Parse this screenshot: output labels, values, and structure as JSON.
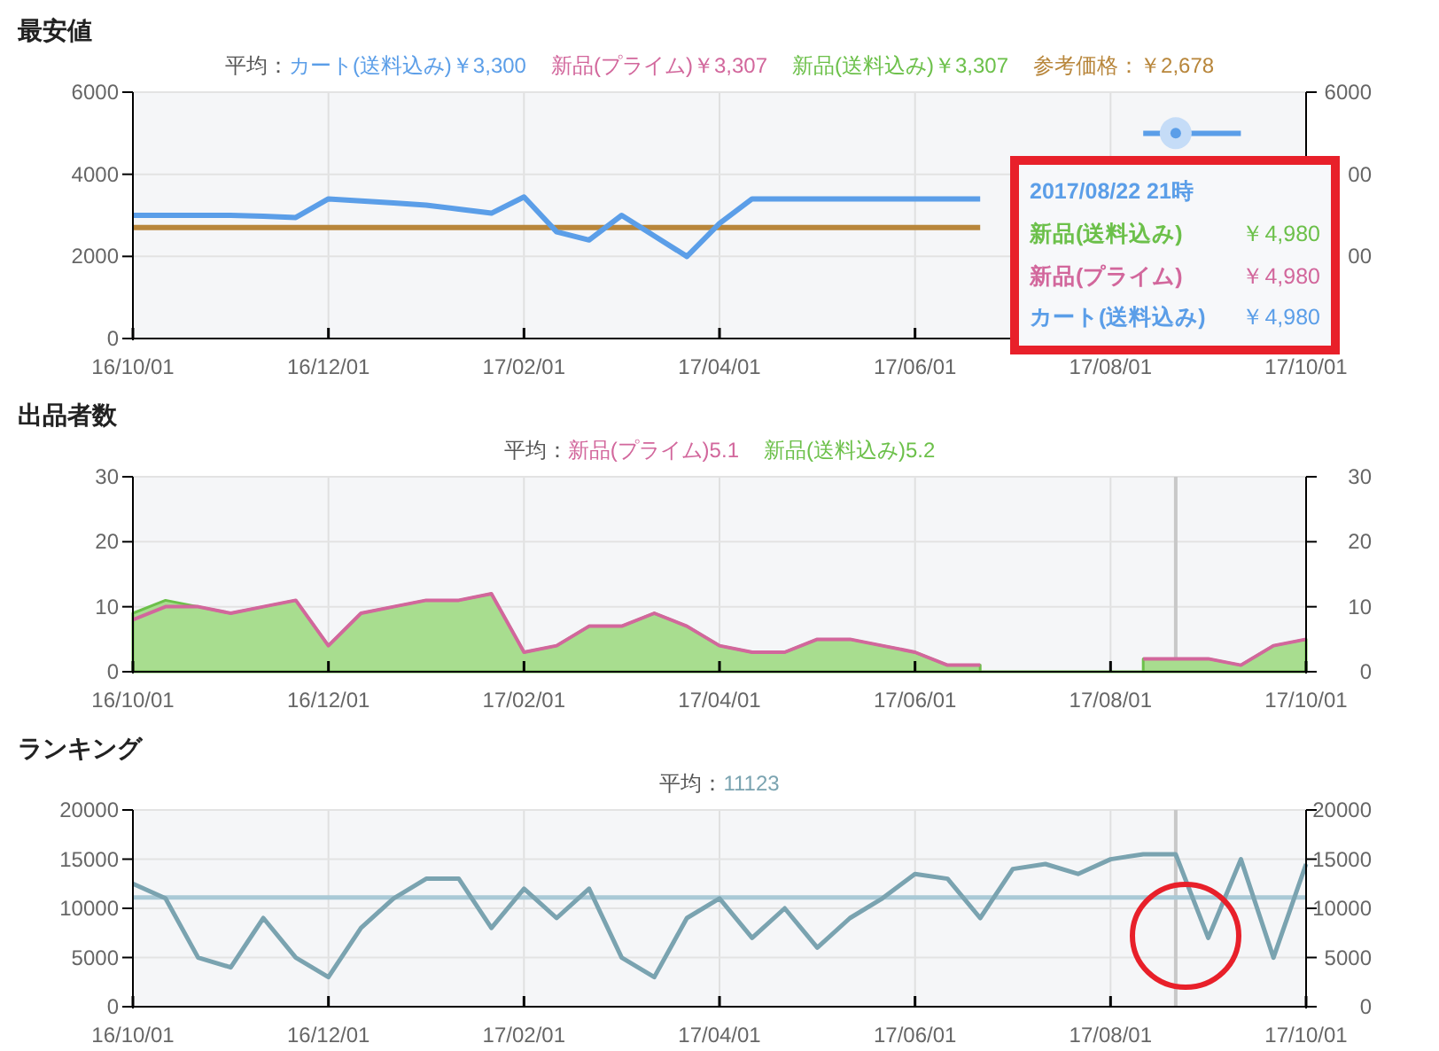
{
  "sections": [
    {
      "title": "最安値",
      "average": {
        "label": "平均：",
        "items": [
          {
            "text": "カート(送料込み)￥3,300",
            "color": "#5b9ee8"
          },
          {
            "text": "新品(プライム)￥3,307",
            "color": "#d2679c"
          },
          {
            "text": "新品(送料込み)￥3,307",
            "color": "#6cc04a"
          },
          {
            "text": "参考価格：￥2,678",
            "color": "#b8863b"
          }
        ]
      },
      "chart_data": {
        "type": "line",
        "categories": [
          "16/10/01",
          null,
          null,
          null,
          null,
          null,
          "16/12/01",
          null,
          null,
          null,
          null,
          null,
          "17/02/01",
          null,
          null,
          null,
          null,
          null,
          "17/04/01",
          null,
          null,
          null,
          null,
          null,
          "17/06/01",
          null,
          null,
          null,
          null,
          null,
          "17/08/01",
          null,
          null,
          null,
          null,
          null,
          "17/10/01"
        ],
        "series": [
          {
            "color": "#b8863b",
            "values": [
              2700,
              2700,
              2700,
              2700,
              2700,
              2700,
              2700,
              2700,
              2700,
              2700,
              2700,
              2700,
              2700,
              2700,
              2700,
              2700,
              2700,
              2700,
              2700,
              2700,
              2700,
              2700,
              2700,
              2700,
              2700,
              2700,
              2700,
              null,
              null,
              null,
              null,
              null,
              null,
              null,
              null,
              null,
              null
            ]
          },
          {
            "color": "#5b9ee8",
            "values": [
              3000,
              3000,
              3000,
              3000,
              2980,
              2950,
              3400,
              3350,
              3300,
              3250,
              3150,
              3050,
              3450,
              2600,
              2400,
              3000,
              2500,
              2000,
              2800,
              3400,
              3400,
              3400,
              3400,
              3400,
              3400,
              3400,
              3400,
              null,
              null,
              null,
              null,
              5000,
              5000,
              5000,
              5000,
              null,
              null
            ]
          }
        ],
        "ylim": [
          0,
          6000
        ],
        "yticks": [
          0,
          2000,
          4000,
          6000
        ],
        "grid": true
      },
      "right_axis": [
        "6000",
        "00",
        "00"
      ],
      "tooltip": {
        "title": "2017/08/22 21時",
        "rows": [
          {
            "label": "新品(送料込み)",
            "value": "￥4,980",
            "color": "#6cc04a"
          },
          {
            "label": "新品(プライム)",
            "value": "￥4,980",
            "color": "#d2679c"
          },
          {
            "label": "カート(送料込み)",
            "value": "￥4,980",
            "color": "#5b9ee8"
          }
        ]
      }
    },
    {
      "title": "出品者数",
      "average": {
        "label": "平均：",
        "items": [
          {
            "text": "新品(プライム)5.1",
            "color": "#d2679c"
          },
          {
            "text": "新品(送料込み)5.2",
            "color": "#6cc04a"
          }
        ]
      },
      "chart_data": {
        "type": "area",
        "categories": [
          "16/10/01",
          null,
          null,
          null,
          null,
          null,
          "16/12/01",
          null,
          null,
          null,
          null,
          null,
          "17/02/01",
          null,
          null,
          null,
          null,
          null,
          "17/04/01",
          null,
          null,
          null,
          null,
          null,
          "17/06/01",
          null,
          null,
          null,
          null,
          null,
          "17/08/01",
          null,
          null,
          null,
          null,
          null,
          "17/10/01"
        ],
        "series": [
          {
            "color": "#6cc04a",
            "values": [
              9,
              11,
              10,
              9,
              10,
              11,
              4,
              9,
              10,
              11,
              11,
              12,
              3,
              4,
              7,
              7,
              9,
              7,
              4,
              3,
              3,
              5,
              5,
              4,
              3,
              1,
              1,
              null,
              null,
              null,
              null,
              2,
              2,
              2,
              1,
              4,
              5
            ]
          },
          {
            "color": "#d2679c",
            "type": "line",
            "values": [
              8,
              10,
              10,
              9,
              10,
              11,
              4,
              9,
              10,
              11,
              11,
              12,
              3,
              4,
              7,
              7,
              9,
              7,
              4,
              3,
              3,
              5,
              5,
              4,
              3,
              1,
              1,
              null,
              null,
              null,
              null,
              2,
              2,
              2,
              1,
              4,
              5
            ]
          }
        ],
        "ylim": [
          0,
          30
        ],
        "yticks": [
          0,
          10,
          20,
          30
        ],
        "grid": true
      },
      "right_axis": [
        "30",
        "20",
        "10",
        "0"
      ]
    },
    {
      "title": "ランキング",
      "average": {
        "label": "平均：",
        "items": [
          {
            "text": "11123",
            "color": "#7aa3b0"
          }
        ]
      },
      "chart_data": {
        "type": "line",
        "categories": [
          "16/10/01",
          null,
          null,
          null,
          null,
          null,
          "16/12/01",
          null,
          null,
          null,
          null,
          null,
          "17/02/01",
          null,
          null,
          null,
          null,
          null,
          "17/04/01",
          null,
          null,
          null,
          null,
          null,
          "17/06/01",
          null,
          null,
          null,
          null,
          null,
          "17/08/01",
          null,
          null,
          null,
          null,
          null,
          "17/10/01"
        ],
        "series": [
          {
            "color": "#a9c9d6",
            "values": [
              11100,
              11100,
              11100,
              11100,
              11100,
              11100,
              11100,
              11100,
              11100,
              11100,
              11100,
              11100,
              11100,
              11100,
              11100,
              11100,
              11100,
              11100,
              11100,
              11100,
              11100,
              11100,
              11100,
              11100,
              11100,
              11100,
              11100,
              11100,
              11100,
              11100,
              11100,
              11100,
              11100,
              11100,
              11100,
              11100,
              11100
            ]
          },
          {
            "color": "#7aa3b0",
            "values": [
              12500,
              11000,
              5000,
              4000,
              9000,
              5000,
              3000,
              8000,
              11000,
              13000,
              13000,
              8000,
              12000,
              9000,
              12000,
              5000,
              3000,
              9000,
              11000,
              7000,
              10000,
              6000,
              9000,
              11000,
              13500,
              13000,
              9000,
              14000,
              14500,
              13500,
              15000,
              15500,
              15500,
              7000,
              15000,
              5000,
              14500
            ]
          }
        ],
        "ylim": [
          0,
          20000
        ],
        "yticks": [
          0,
          5000,
          10000,
          15000,
          20000
        ],
        "grid": true
      },
      "right_axis": [
        "20000",
        "15000",
        "10000",
        "5000",
        "0"
      ]
    }
  ]
}
